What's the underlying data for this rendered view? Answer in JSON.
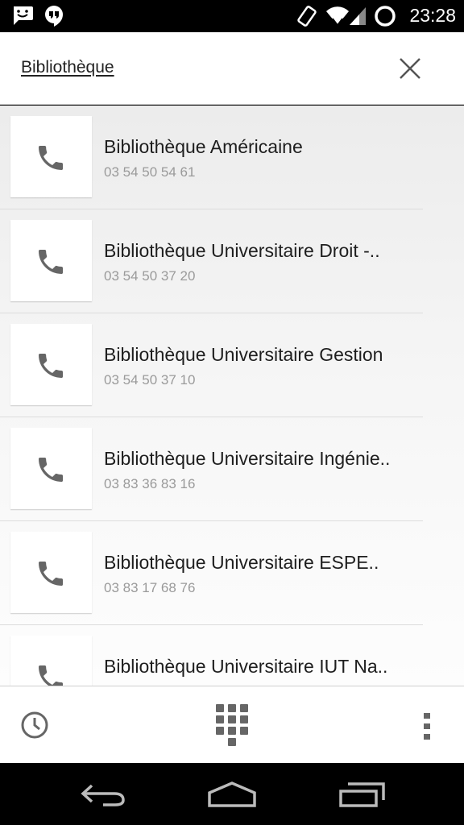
{
  "status_bar": {
    "time": "23:28",
    "icons": [
      "chat-icon",
      "hangouts-icon",
      "rotation-icon",
      "wifi-icon",
      "signal-icon",
      "sync-icon"
    ]
  },
  "search": {
    "query": "Bibliothèque",
    "close_icon": "close-icon"
  },
  "results": [
    {
      "name": "Bibliothèque Américaine",
      "number": "03 54 50 54 61"
    },
    {
      "name": "Bibliothèque Universitaire Droit -..",
      "number": "03 54 50 37 20"
    },
    {
      "name": "Bibliothèque Universitaire Gestion",
      "number": "03 54 50 37 10"
    },
    {
      "name": "Bibliothèque Universitaire Ingénie..",
      "number": "03 83 36 83 16"
    },
    {
      "name": "Bibliothèque Universitaire ESPE..",
      "number": "03 83 17 68 76"
    },
    {
      "name": "Bibliothèque Universitaire IUT Na..",
      "number": ""
    }
  ],
  "action_bar": {
    "icons": [
      "history-icon",
      "dialpad-icon",
      "overflow-menu-icon"
    ]
  },
  "nav_bar": {
    "icons": [
      "back-icon",
      "home-icon",
      "recents-icon"
    ]
  },
  "colors": {
    "status_bar": "#000000",
    "header_bg": "#ffffff",
    "list_bg": "#ececec",
    "icon_gray": "#666666",
    "number_gray": "#9a9a9a"
  }
}
